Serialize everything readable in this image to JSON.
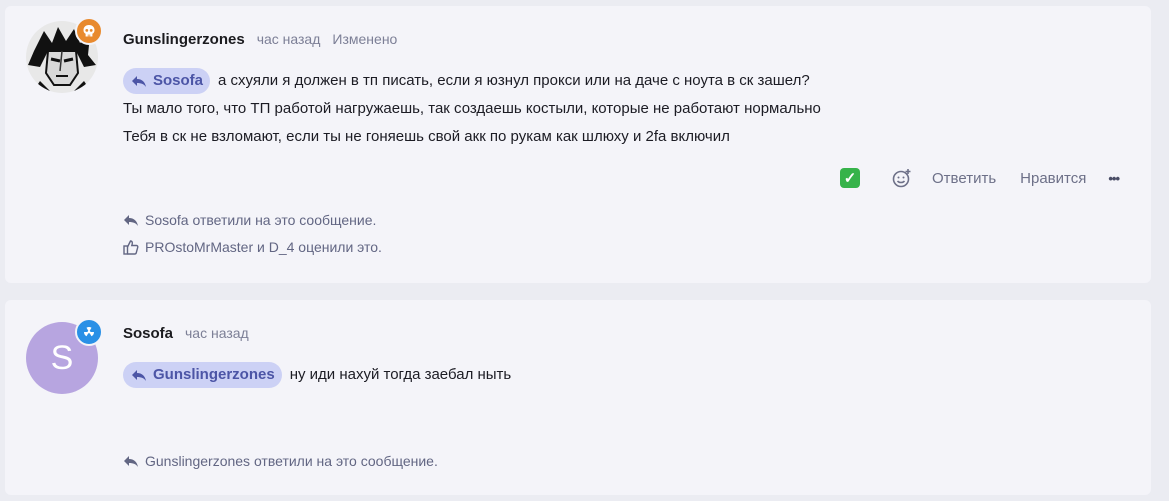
{
  "post1": {
    "author": "Gunslingerzones",
    "time": "час назад",
    "edited": "Изменено",
    "mention": "Sosofa",
    "lines": [
      "а схуяли я должен в тп писать, если я юзнул прокси или на даче с ноута в ск зашел?",
      "Ты мало того, что ТП работой нагружаешь, так создаешь костыли, которые не работают нормально",
      "Тебя в ск не взломают, если ты не гоняешь свой акк по рукам как шлюху и 2fa включил"
    ],
    "actions": {
      "check_icon": "check-mark-icon",
      "reply": "Ответить",
      "like": "Нравится",
      "more": "•••"
    },
    "replied": "Sosofa ответили на это сообщение.",
    "liked": "PROstoMrMaster и D_4 оценили это."
  },
  "post2": {
    "author": "Sosofa",
    "avatar_letter": "S",
    "time": "час назад",
    "mention": "Gunslingerzones",
    "text": "ну иди нахуй тогда заебал ныть",
    "replied": "Gunslingerzones ответили на это сообщение."
  },
  "colors": {
    "page_bg": "#ebecf2",
    "card_bg": "#f4f4f9",
    "mention_bg": "#ccd1f5",
    "mention_text": "#4c55a6",
    "badge_orange": "#e88a2e",
    "badge_blue": "#2a90e6",
    "avatar_purple": "#b7a5e0"
  }
}
